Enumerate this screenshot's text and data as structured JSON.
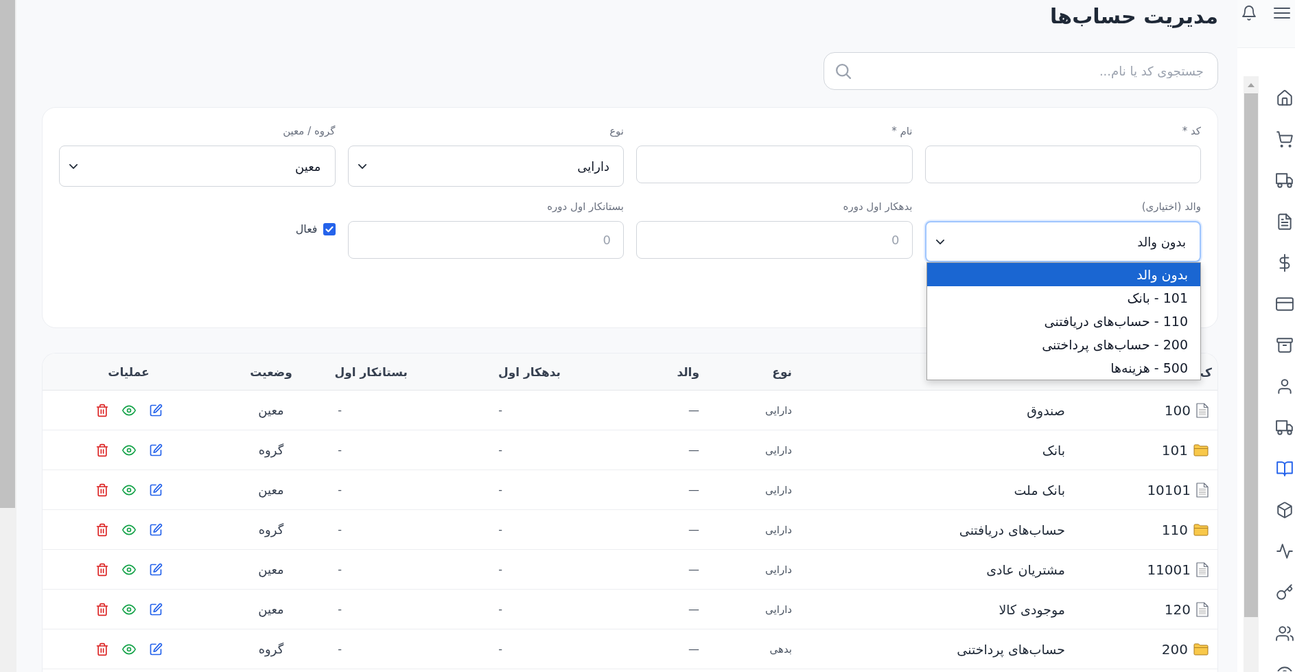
{
  "sidebar": {
    "items": [
      {
        "selected": false
      },
      {
        "selected": false
      },
      {
        "selected": false
      },
      {
        "selected": false
      },
      {
        "selected": false
      },
      {
        "selected": false
      },
      {
        "selected": false
      },
      {
        "selected": false
      },
      {
        "selected": false
      },
      {
        "selected": true
      },
      {
        "selected": false
      },
      {
        "selected": false
      },
      {
        "selected": false
      },
      {
        "selected": false
      },
      {
        "selected": false
      }
    ]
  },
  "page": {
    "title": "مدیریت حساب‌ها",
    "search": {
      "placeholder": "جستجوی کد یا نام..."
    }
  },
  "form": {
    "fields": [
      {
        "kind": "text",
        "label": "کد *"
      },
      {
        "kind": "text",
        "label": "نام *"
      },
      {
        "kind": "select",
        "label": "نوع",
        "value": "دارایی",
        "expanded": false
      },
      {
        "kind": "select",
        "label": "گروه / معین",
        "value": "معین",
        "expanded": false
      },
      {
        "kind": "select",
        "label": "والد (اختیاری)",
        "value": "بدون والد",
        "expanded": true,
        "options": [
          {
            "label": "بدون والد",
            "selected": true
          },
          {
            "label": "101 - بانک",
            "selected": false
          },
          {
            "label": "110 - حساب‌های دریافتنی",
            "selected": false
          },
          {
            "label": "200 - حساب‌های پرداختنی",
            "selected": false
          },
          {
            "label": "500 - هزینه‌ها",
            "selected": false
          }
        ]
      },
      {
        "kind": "text",
        "label": "بدهکار اول دوره",
        "placeholder": "0"
      },
      {
        "kind": "text",
        "label": "بستانکار اول دوره",
        "placeholder": "0"
      },
      {
        "kind": "checkbox",
        "label": "فعال",
        "checked": true
      }
    ]
  },
  "table": {
    "columns": [
      {
        "label": "ک"
      },
      {},
      {
        "label": "نوع"
      },
      {
        "label": "والد"
      },
      {
        "label": "بدهکار اول"
      },
      {
        "label": "بستانکار اول"
      },
      {
        "label": "وضعیت"
      },
      {
        "label": "عملیات"
      }
    ],
    "rows": [
      {
        "kind": "leaf",
        "code": "100",
        "name": "صندوق",
        "type": "دارایی",
        "parent": "—",
        "debit": "-",
        "credit": "-",
        "status": "معین"
      },
      {
        "kind": "group",
        "code": "101",
        "name": "بانک",
        "type": "دارایی",
        "parent": "—",
        "debit": "-",
        "credit": "-",
        "status": "گروه"
      },
      {
        "kind": "leaf",
        "code": "10101",
        "name": "بانک ملت",
        "type": "دارایی",
        "parent": "—",
        "debit": "-",
        "credit": "-",
        "status": "معین"
      },
      {
        "kind": "group",
        "code": "110",
        "name": "حساب‌های دریافتنی",
        "type": "دارایی",
        "parent": "—",
        "debit": "-",
        "credit": "-",
        "status": "گروه"
      },
      {
        "kind": "leaf",
        "code": "11001",
        "name": "مشتریان عادی",
        "type": "دارایی",
        "parent": "—",
        "debit": "-",
        "credit": "-",
        "status": "معین"
      },
      {
        "kind": "leaf",
        "code": "120",
        "name": "موجودی کالا",
        "type": "دارایی",
        "parent": "—",
        "debit": "-",
        "credit": "-",
        "status": "معین"
      },
      {
        "kind": "group",
        "code": "200",
        "name": "حساب‌های پرداختنی",
        "type": "بدهی",
        "parent": "—",
        "debit": "-",
        "credit": "-",
        "status": "گروه"
      }
    ]
  }
}
